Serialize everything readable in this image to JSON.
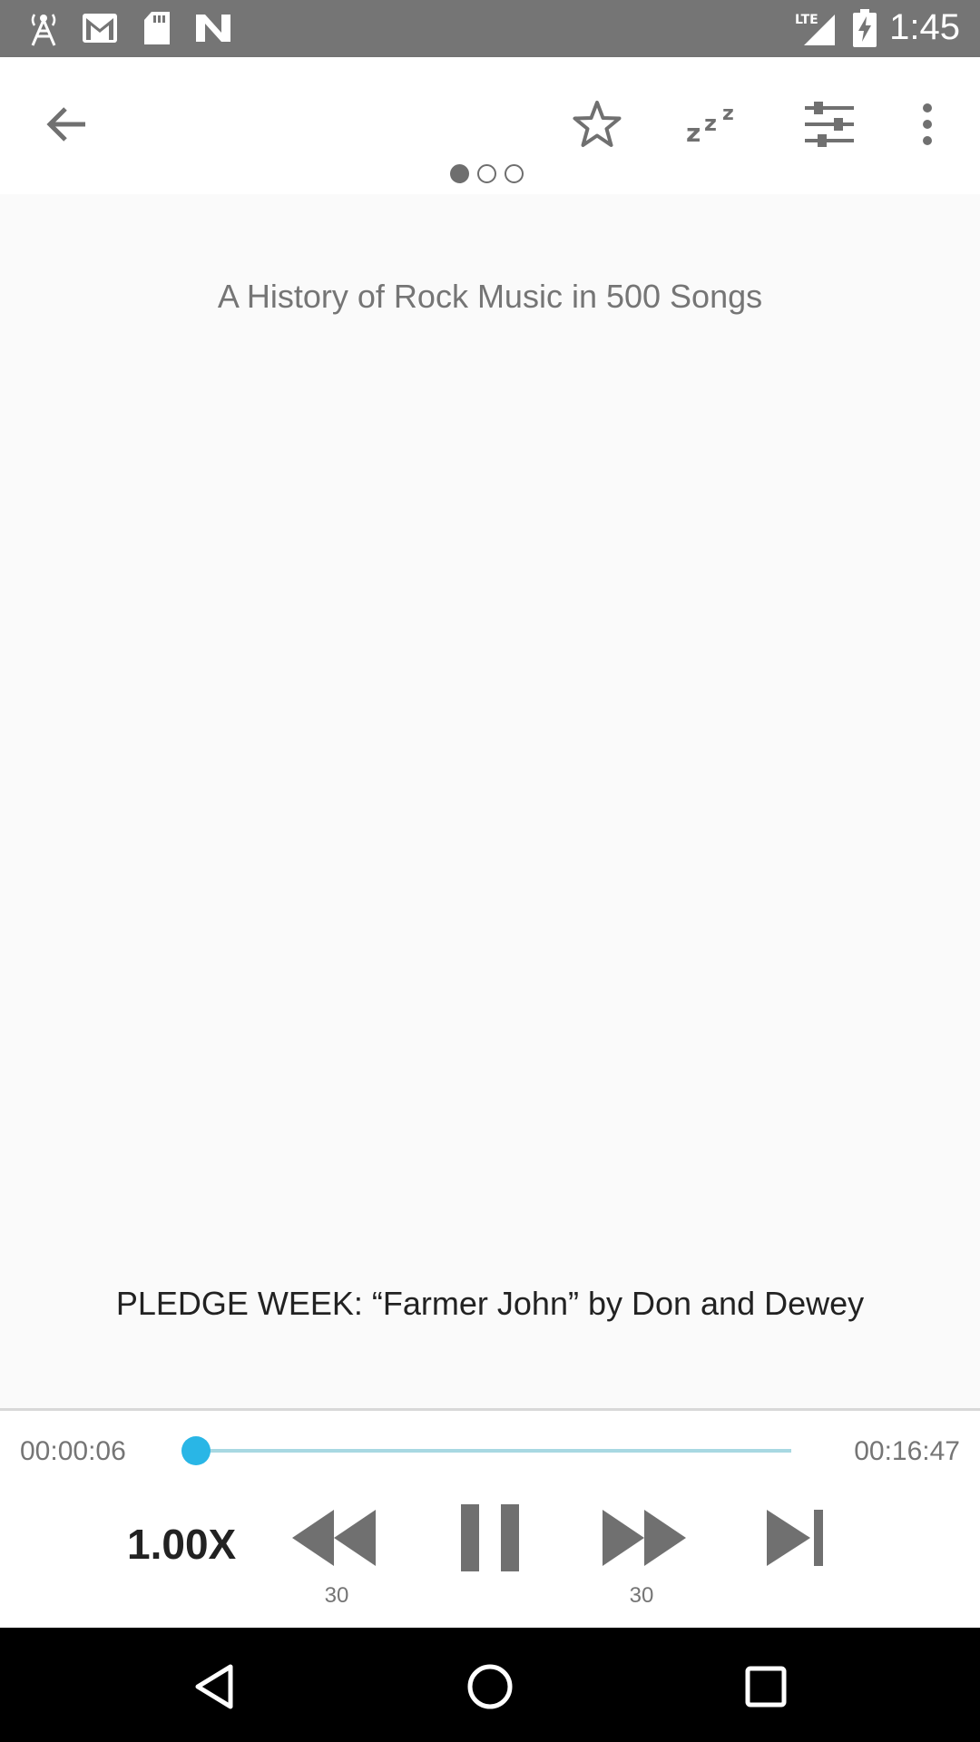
{
  "status_bar": {
    "time": "1:45",
    "network": "LTE",
    "icons": [
      "antenna-icon",
      "gmail-icon",
      "sd-card-icon",
      "n-logo-icon",
      "signal-icon",
      "battery-charging-icon"
    ]
  },
  "toolbar": {
    "icons": [
      "back-arrow-icon",
      "star-icon",
      "sleep-timer-icon",
      "equalizer-icon",
      "more-vert-icon"
    ],
    "page_indicator": {
      "count": 3,
      "active_index": 0
    }
  },
  "content": {
    "podcast_title": "A History of Rock Music in 500 Songs",
    "episode_title": "PLEDGE WEEK: “Farmer John” by Don and Dewey"
  },
  "player": {
    "elapsed": "00:00:06",
    "duration": "00:16:47",
    "progress_fraction": 0.006,
    "speed_label": "1.00X",
    "rewind_label": "30",
    "forward_label": "30",
    "accent_color": "#29b6e6",
    "icons": [
      "rewind-icon",
      "pause-icon",
      "fast-forward-icon",
      "skip-next-icon"
    ]
  },
  "nav_bar": {
    "icons": [
      "back-triangle-icon",
      "home-circle-icon",
      "recents-square-icon"
    ]
  }
}
